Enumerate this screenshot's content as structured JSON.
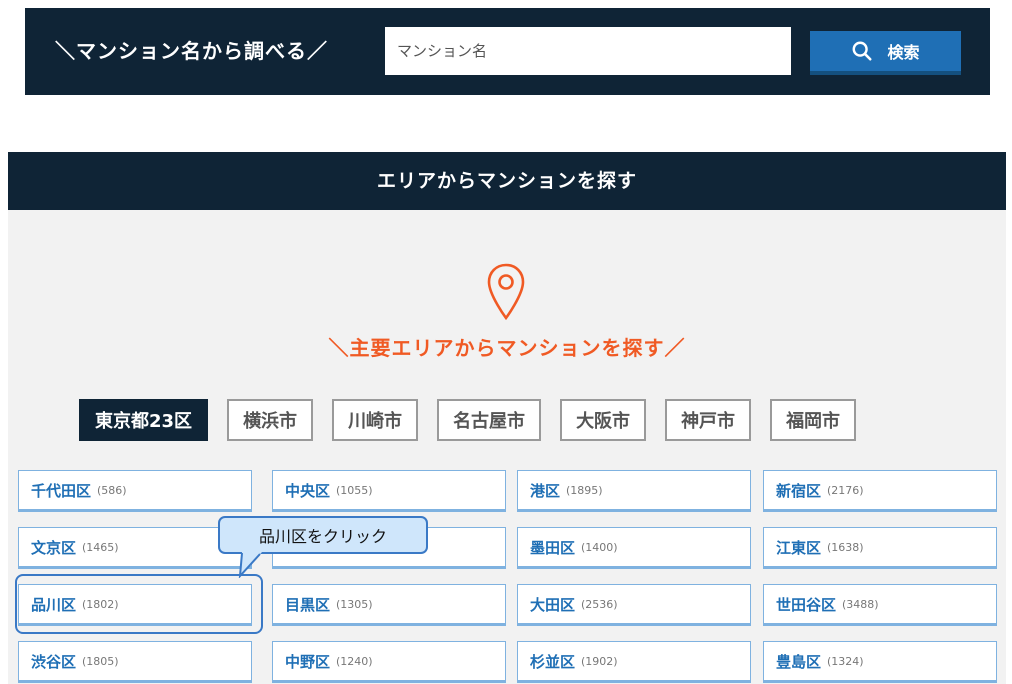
{
  "search": {
    "title": "＼マンション名から調べる／",
    "placeholder": "マンション名",
    "button_label": "検索"
  },
  "area": {
    "header": "エリアからマンションを探す",
    "sub_heading": "＼主要エリアからマンションを探す／",
    "tabs": [
      {
        "label": "東京都23区",
        "active": true
      },
      {
        "label": "横浜市"
      },
      {
        "label": "川崎市"
      },
      {
        "label": "名古屋市"
      },
      {
        "label": "大阪市"
      },
      {
        "label": "神戸市"
      },
      {
        "label": "福岡市"
      }
    ],
    "wards": [
      {
        "name": "千代田区",
        "count": "(586)"
      },
      {
        "name": "中央区",
        "count": "(1055)"
      },
      {
        "name": "港区",
        "count": "(1895)"
      },
      {
        "name": "新宿区",
        "count": "(2176)"
      },
      {
        "name": "文京区",
        "count": "(1465)"
      },
      {
        "name": "",
        "count": ""
      },
      {
        "name": "墨田区",
        "count": "(1400)"
      },
      {
        "name": "江東区",
        "count": "(1638)"
      },
      {
        "name": "品川区",
        "count": "(1802)"
      },
      {
        "name": "目黒区",
        "count": "(1305)"
      },
      {
        "name": "大田区",
        "count": "(2536)"
      },
      {
        "name": "世田谷区",
        "count": "(3488)"
      },
      {
        "name": "渋谷区",
        "count": "(1805)"
      },
      {
        "name": "中野区",
        "count": "(1240)"
      },
      {
        "name": "杉並区",
        "count": "(1902)"
      },
      {
        "name": "豊島区",
        "count": "(1324)"
      }
    ]
  },
  "annotation": {
    "callout_text": "品川区をクリック"
  },
  "colors": {
    "navy": "#0f2436",
    "accent_orange": "#f05a24",
    "link_blue": "#1f6fb5",
    "callout_fill": "#cfe6fb"
  }
}
